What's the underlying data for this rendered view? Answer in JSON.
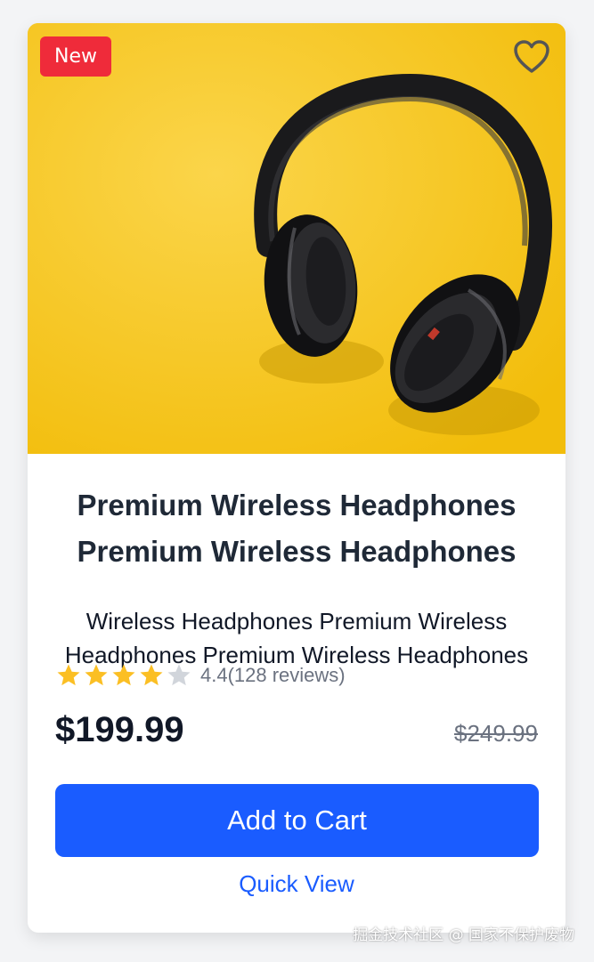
{
  "product": {
    "badge": "New",
    "favorite_icon": "heart-outline-icon",
    "title": "Premium Wireless Headphones Premium Wireless Headphones",
    "description": "Wireless Headphones Premium Wireless Headphones Premium Wireless Headphones",
    "rating": {
      "value": 4.4,
      "max": 5,
      "display": "4.4(128 reviews)"
    },
    "price": "$199.99",
    "original_price": "$249.99",
    "add_to_cart_label": "Add to Cart",
    "quick_view_label": "Quick View"
  },
  "watermark": "掘金技术社区 @ 国家不保护废物",
  "colors": {
    "accent": "#1a5cff",
    "badge": "#ef2b3a",
    "star_filled": "#fbbf24",
    "star_empty": "#d1d5db",
    "image_background": "#f7c81a"
  }
}
